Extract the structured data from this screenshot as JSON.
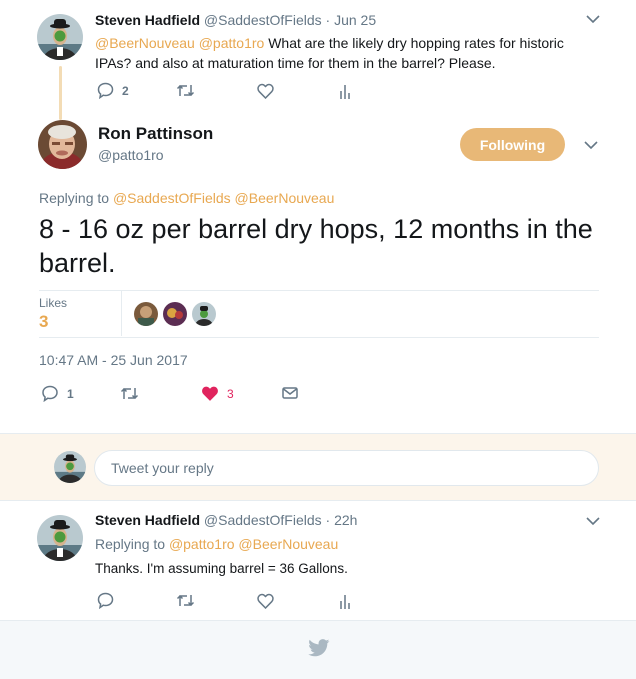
{
  "tweet1": {
    "name": "Steven Hadfield",
    "handle": "@SaddestOfFields",
    "separator": "·",
    "time": "Jun 25",
    "mention1": "@BeerNouveau",
    "mention2": "@patto1ro",
    "text": "What are the likely dry hopping rates for historic IPAs? and also at maturation time for them in the barrel? Please.",
    "reply_count": "2"
  },
  "main": {
    "name": "Ron Pattinson",
    "handle": "@patto1ro",
    "follow_label": "Following",
    "replying_prefix": "Replying to",
    "replying_to1": "@SaddestOfFields",
    "replying_to2": "@BeerNouveau",
    "text": "8 - 16 oz per barrel dry hops, 12 months in the barrel.",
    "likes_label": "Likes",
    "likes_count": "3",
    "timestamp": "10:47 AM - 25 Jun 2017",
    "reply_count": "1",
    "like_count": "3"
  },
  "composer": {
    "placeholder": "Tweet your reply"
  },
  "tweet3": {
    "name": "Steven Hadfield",
    "handle": "@SaddestOfFields",
    "separator": "·",
    "time": "22h",
    "replying_prefix": "Replying to",
    "replying_to1": "@patto1ro",
    "replying_to2": "@BeerNouveau",
    "text": "Thanks. I'm assuming barrel = 36 Gallons."
  },
  "colors": {
    "accent": "#e8a851",
    "like_red": "#e0245e",
    "icon_gray": "#657786"
  },
  "icons": [
    "reply-icon",
    "retweet-icon",
    "like-icon",
    "stats-icon",
    "dm-icon",
    "chevron-down-icon",
    "bird-icon"
  ]
}
